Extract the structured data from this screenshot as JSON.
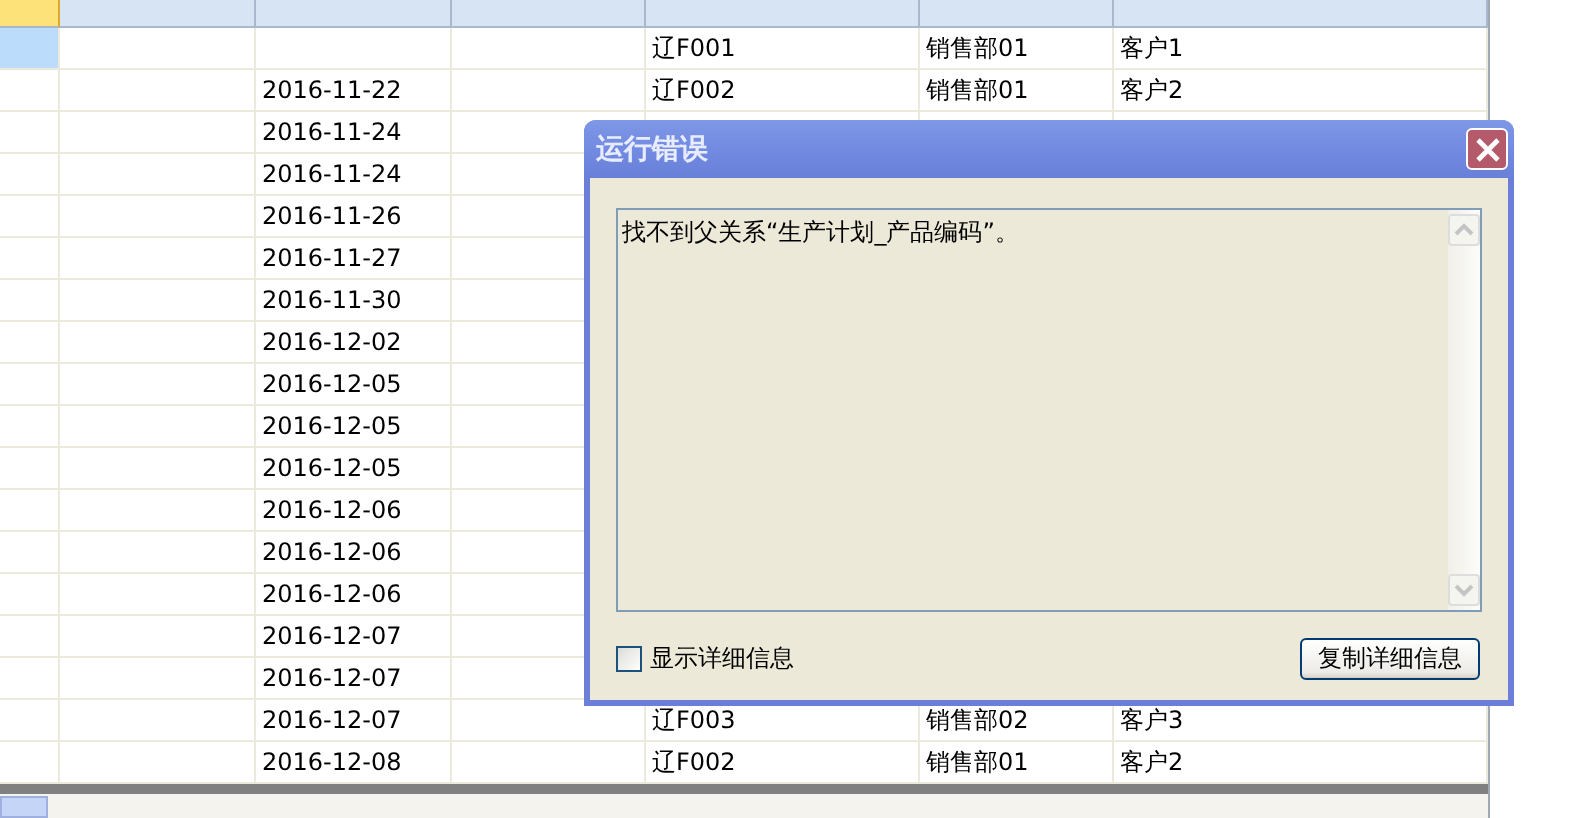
{
  "grid": {
    "rows": [
      {
        "selected": true,
        "date": "",
        "code": "辽F001",
        "dept": "销售部01",
        "customer": "客户1"
      },
      {
        "selected": false,
        "date": "2016-11-22",
        "code": "辽F002",
        "dept": "销售部01",
        "customer": "客户2"
      },
      {
        "selected": false,
        "date": "2016-11-24"
      },
      {
        "selected": false,
        "date": "2016-11-24"
      },
      {
        "selected": false,
        "date": "2016-11-26"
      },
      {
        "selected": false,
        "date": "2016-11-27"
      },
      {
        "selected": false,
        "date": "2016-11-30"
      },
      {
        "selected": false,
        "date": "2016-12-02"
      },
      {
        "selected": false,
        "date": "2016-12-05"
      },
      {
        "selected": false,
        "date": "2016-12-05"
      },
      {
        "selected": false,
        "date": "2016-12-05"
      },
      {
        "selected": false,
        "date": "2016-12-06"
      },
      {
        "selected": false,
        "date": "2016-12-06"
      },
      {
        "selected": false,
        "date": "2016-12-06"
      },
      {
        "selected": false,
        "date": "2016-12-07"
      },
      {
        "selected": false,
        "date": "2016-12-07"
      },
      {
        "selected": false,
        "date": "2016-12-07",
        "code": "辽F003",
        "dept": "销售部02",
        "customer": "客户3"
      },
      {
        "selected": false,
        "date": "2016-12-08",
        "code": "辽F002",
        "dept": "销售部01",
        "customer": "客户2"
      }
    ]
  },
  "dialog": {
    "title": "运行错误",
    "message": "找不到父关系“生产计划_产品编码”。",
    "checkbox": {
      "label": "显示详细信息",
      "checked": false
    },
    "button": "复制详细信息"
  }
}
